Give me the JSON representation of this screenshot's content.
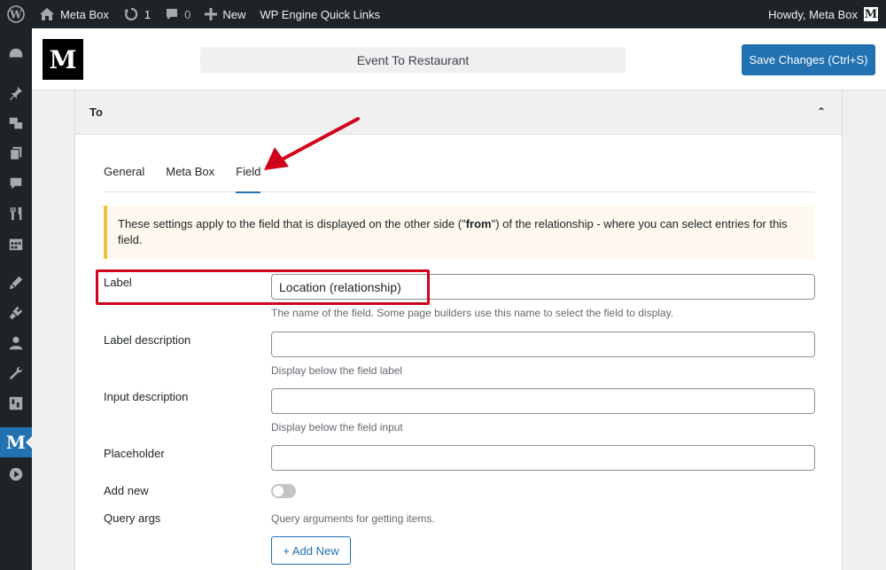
{
  "adminbar": {
    "site_name": "Meta Box",
    "updates_count": "1",
    "comments_count": "0",
    "new_label": "New",
    "quicklinks_label": "WP Engine Quick Links",
    "howdy": "Howdy, Meta Box",
    "user_avatar_letter": "M"
  },
  "header": {
    "logo_letter": "M",
    "title": "Event To Restaurant",
    "save_label": "Save Changes (Ctrl+S)"
  },
  "panel": {
    "title": "To",
    "collapse_glyph": "⌃",
    "tabs": [
      {
        "label": "General",
        "active": false
      },
      {
        "label": "Meta Box",
        "active": false
      },
      {
        "label": "Field",
        "active": true
      }
    ],
    "notice": {
      "text_before": "These settings apply to the field that is displayed on the other side (\"",
      "text_bold": "from",
      "text_after": "\") of the relationship - where you can select entries for this field."
    },
    "fields": {
      "label": {
        "label": "Label",
        "value": "Location (relationship)",
        "description": "The name of the field. Some page builders use this name to select the field to display."
      },
      "label_description": {
        "label": "Label description",
        "value": "",
        "description": "Display below the field label"
      },
      "input_description": {
        "label": "Input description",
        "value": "",
        "description": "Display below the field input"
      },
      "placeholder": {
        "label": "Placeholder",
        "value": ""
      },
      "add_new": {
        "label": "Add new",
        "enabled": false
      },
      "query_args": {
        "label": "Query args",
        "description": "Query arguments for getting items.",
        "button": "+ Add New"
      }
    }
  },
  "sidebar": {
    "active_letter": "M",
    "icons": [
      "dashboard-icon",
      "pin-icon",
      "media-icon",
      "pages-icon",
      "comments-icon",
      "restaurant-icon",
      "calendar-icon",
      "appearance-icon",
      "plugins-icon",
      "users-icon",
      "tools-icon",
      "settings-icon",
      "metabox-icon",
      "play-icon"
    ]
  },
  "colors": {
    "accent": "#2271b1",
    "adminbar": "#1d2327",
    "highlight": "#d0021b",
    "notice_border": "#f0c33c"
  }
}
